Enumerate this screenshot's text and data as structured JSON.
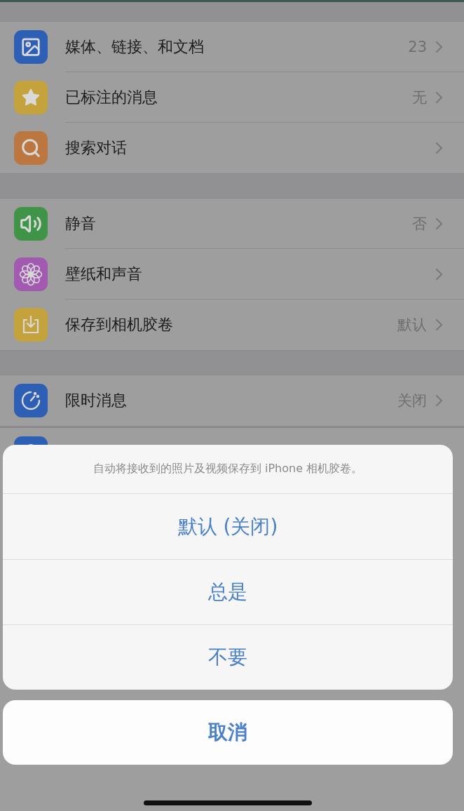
{
  "sections": [
    {
      "rows": [
        {
          "label": "媒体、链接、和文档",
          "value": "23"
        },
        {
          "label": "已标注的消息",
          "value": "无"
        },
        {
          "label": "搜索对话"
        }
      ]
    },
    {
      "rows": [
        {
          "label": "静音",
          "value": "否"
        },
        {
          "label": "壁纸和声音"
        },
        {
          "label": "保存到相机胶卷",
          "value": "默认"
        }
      ]
    },
    {
      "rows": [
        {
          "label": "限时消息",
          "value": "关闭"
        }
      ]
    }
  ],
  "action_sheet": {
    "message": "自动将接收到的照片及视频保存到 iPhone 相机胶卷。",
    "options": [
      "默认 (关闭)",
      "总是",
      "不要"
    ],
    "cancel": "取消"
  }
}
